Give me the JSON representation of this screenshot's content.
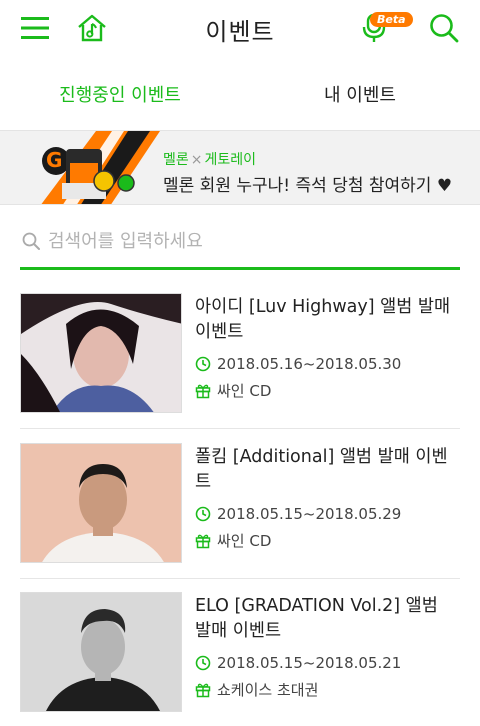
{
  "header": {
    "title": "이벤트",
    "beta": "Beta"
  },
  "tabs": [
    {
      "label": "진행중인 이벤트",
      "active": true
    },
    {
      "label": "내 이벤트",
      "active": false
    }
  ],
  "banner": {
    "brand1": "멜론",
    "brand_sep": "×",
    "brand2": "게토레이",
    "text": "멜론 회원 누구나! 즉석 당첨 참여하기 ♥"
  },
  "search": {
    "placeholder": "검색어를 입력하세요"
  },
  "events": [
    {
      "title": "아이디 [Luv Highway] 앨범 발매 이벤트",
      "date": "2018.05.16~2018.05.30",
      "reward": "싸인 CD"
    },
    {
      "title": "폴킴 [Additional] 앨범 발매 이벤트",
      "date": "2018.05.15~2018.05.29",
      "reward": "싸인 CD"
    },
    {
      "title": "ELO [GRADATION Vol.2] 앨범 발매 이벤트",
      "date": "2018.05.15~2018.05.21",
      "reward": "쇼케이스 초대권"
    }
  ],
  "colors": {
    "accent": "#1bbb1b",
    "beta_badge": "#ff7a00"
  }
}
